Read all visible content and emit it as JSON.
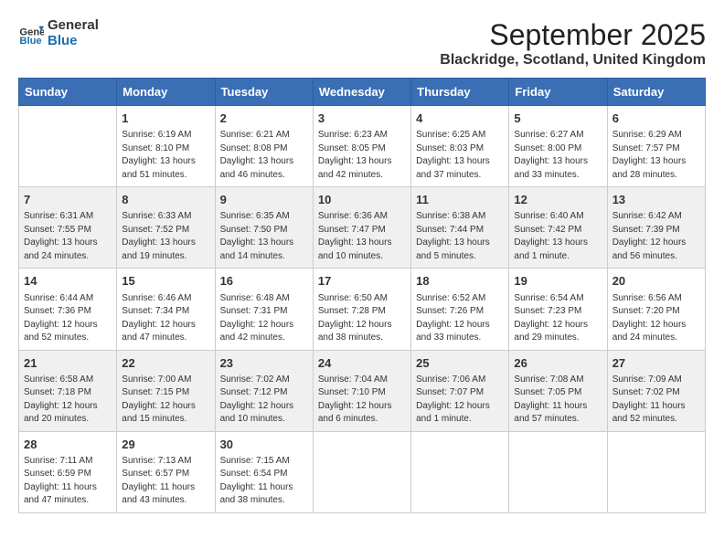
{
  "header": {
    "logo_line1": "General",
    "logo_line2": "Blue",
    "title": "September 2025",
    "subtitle": "Blackridge, Scotland, United Kingdom"
  },
  "weekdays": [
    "Sunday",
    "Monday",
    "Tuesday",
    "Wednesday",
    "Thursday",
    "Friday",
    "Saturday"
  ],
  "weeks": [
    [
      {
        "day": "",
        "info": ""
      },
      {
        "day": "1",
        "info": "Sunrise: 6:19 AM\nSunset: 8:10 PM\nDaylight: 13 hours\nand 51 minutes."
      },
      {
        "day": "2",
        "info": "Sunrise: 6:21 AM\nSunset: 8:08 PM\nDaylight: 13 hours\nand 46 minutes."
      },
      {
        "day": "3",
        "info": "Sunrise: 6:23 AM\nSunset: 8:05 PM\nDaylight: 13 hours\nand 42 minutes."
      },
      {
        "day": "4",
        "info": "Sunrise: 6:25 AM\nSunset: 8:03 PM\nDaylight: 13 hours\nand 37 minutes."
      },
      {
        "day": "5",
        "info": "Sunrise: 6:27 AM\nSunset: 8:00 PM\nDaylight: 13 hours\nand 33 minutes."
      },
      {
        "day": "6",
        "info": "Sunrise: 6:29 AM\nSunset: 7:57 PM\nDaylight: 13 hours\nand 28 minutes."
      }
    ],
    [
      {
        "day": "7",
        "info": "Sunrise: 6:31 AM\nSunset: 7:55 PM\nDaylight: 13 hours\nand 24 minutes."
      },
      {
        "day": "8",
        "info": "Sunrise: 6:33 AM\nSunset: 7:52 PM\nDaylight: 13 hours\nand 19 minutes."
      },
      {
        "day": "9",
        "info": "Sunrise: 6:35 AM\nSunset: 7:50 PM\nDaylight: 13 hours\nand 14 minutes."
      },
      {
        "day": "10",
        "info": "Sunrise: 6:36 AM\nSunset: 7:47 PM\nDaylight: 13 hours\nand 10 minutes."
      },
      {
        "day": "11",
        "info": "Sunrise: 6:38 AM\nSunset: 7:44 PM\nDaylight: 13 hours\nand 5 minutes."
      },
      {
        "day": "12",
        "info": "Sunrise: 6:40 AM\nSunset: 7:42 PM\nDaylight: 13 hours\nand 1 minute."
      },
      {
        "day": "13",
        "info": "Sunrise: 6:42 AM\nSunset: 7:39 PM\nDaylight: 12 hours\nand 56 minutes."
      }
    ],
    [
      {
        "day": "14",
        "info": "Sunrise: 6:44 AM\nSunset: 7:36 PM\nDaylight: 12 hours\nand 52 minutes."
      },
      {
        "day": "15",
        "info": "Sunrise: 6:46 AM\nSunset: 7:34 PM\nDaylight: 12 hours\nand 47 minutes."
      },
      {
        "day": "16",
        "info": "Sunrise: 6:48 AM\nSunset: 7:31 PM\nDaylight: 12 hours\nand 42 minutes."
      },
      {
        "day": "17",
        "info": "Sunrise: 6:50 AM\nSunset: 7:28 PM\nDaylight: 12 hours\nand 38 minutes."
      },
      {
        "day": "18",
        "info": "Sunrise: 6:52 AM\nSunset: 7:26 PM\nDaylight: 12 hours\nand 33 minutes."
      },
      {
        "day": "19",
        "info": "Sunrise: 6:54 AM\nSunset: 7:23 PM\nDaylight: 12 hours\nand 29 minutes."
      },
      {
        "day": "20",
        "info": "Sunrise: 6:56 AM\nSunset: 7:20 PM\nDaylight: 12 hours\nand 24 minutes."
      }
    ],
    [
      {
        "day": "21",
        "info": "Sunrise: 6:58 AM\nSunset: 7:18 PM\nDaylight: 12 hours\nand 20 minutes."
      },
      {
        "day": "22",
        "info": "Sunrise: 7:00 AM\nSunset: 7:15 PM\nDaylight: 12 hours\nand 15 minutes."
      },
      {
        "day": "23",
        "info": "Sunrise: 7:02 AM\nSunset: 7:12 PM\nDaylight: 12 hours\nand 10 minutes."
      },
      {
        "day": "24",
        "info": "Sunrise: 7:04 AM\nSunset: 7:10 PM\nDaylight: 12 hours\nand 6 minutes."
      },
      {
        "day": "25",
        "info": "Sunrise: 7:06 AM\nSunset: 7:07 PM\nDaylight: 12 hours\nand 1 minute."
      },
      {
        "day": "26",
        "info": "Sunrise: 7:08 AM\nSunset: 7:05 PM\nDaylight: 11 hours\nand 57 minutes."
      },
      {
        "day": "27",
        "info": "Sunrise: 7:09 AM\nSunset: 7:02 PM\nDaylight: 11 hours\nand 52 minutes."
      }
    ],
    [
      {
        "day": "28",
        "info": "Sunrise: 7:11 AM\nSunset: 6:59 PM\nDaylight: 11 hours\nand 47 minutes."
      },
      {
        "day": "29",
        "info": "Sunrise: 7:13 AM\nSunset: 6:57 PM\nDaylight: 11 hours\nand 43 minutes."
      },
      {
        "day": "30",
        "info": "Sunrise: 7:15 AM\nSunset: 6:54 PM\nDaylight: 11 hours\nand 38 minutes."
      },
      {
        "day": "",
        "info": ""
      },
      {
        "day": "",
        "info": ""
      },
      {
        "day": "",
        "info": ""
      },
      {
        "day": "",
        "info": ""
      }
    ]
  ]
}
